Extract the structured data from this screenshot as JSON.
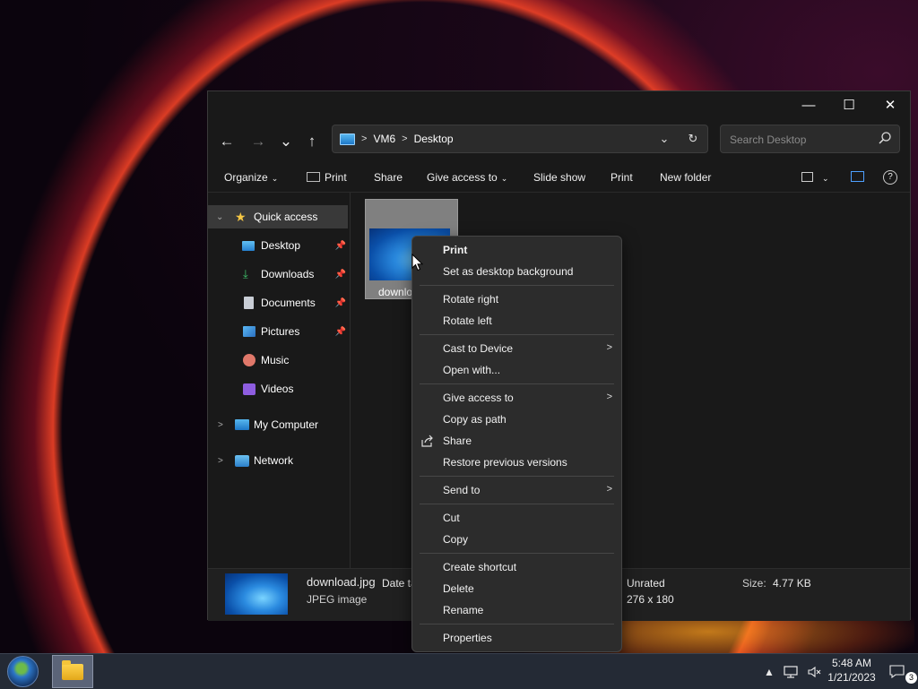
{
  "window": {
    "title_buttons": {
      "minimize": "—",
      "maximize": "☐",
      "close": "✕"
    }
  },
  "nav": {
    "back": "←",
    "forward": "→",
    "recent": "⌄",
    "up": "↑"
  },
  "address": {
    "crumbs": [
      "VM6",
      "Desktop"
    ],
    "dropdown": "⌄",
    "refresh": "↻"
  },
  "search": {
    "placeholder": "Search Desktop"
  },
  "commandbar": {
    "organize": "Organize",
    "print1": "Print",
    "share": "Share",
    "give_access": "Give access to",
    "slideshow": "Slide show",
    "print2": "Print",
    "new_folder": "New folder"
  },
  "sidebar": {
    "quick_access": "Quick access",
    "items": [
      "Desktop",
      "Downloads",
      "Documents",
      "Pictures",
      "Music",
      "Videos"
    ],
    "my_computer": "My Computer",
    "network": "Network"
  },
  "file": {
    "name": "downlo"
  },
  "details": {
    "filename": "download.jpg",
    "date_label": "Date ta",
    "type": "JPEG image",
    "rating": "Unrated",
    "dimensions": "276 x 180",
    "size_label": "Size:",
    "size_value": "4.77 KB"
  },
  "context_menu": {
    "print": "Print",
    "set_background": "Set as desktop background",
    "rotate_right": "Rotate right",
    "rotate_left": "Rotate left",
    "cast": "Cast to Device",
    "open_with": "Open with...",
    "give_access": "Give access to",
    "copy_path": "Copy as path",
    "share": "Share",
    "restore": "Restore previous versions",
    "send_to": "Send to",
    "cut": "Cut",
    "copy": "Copy",
    "create_shortcut": "Create shortcut",
    "delete": "Delete",
    "rename": "Rename",
    "properties": "Properties"
  },
  "taskbar": {
    "time": "5:48 AM",
    "date": "1/21/2023",
    "notification_count": "3"
  }
}
